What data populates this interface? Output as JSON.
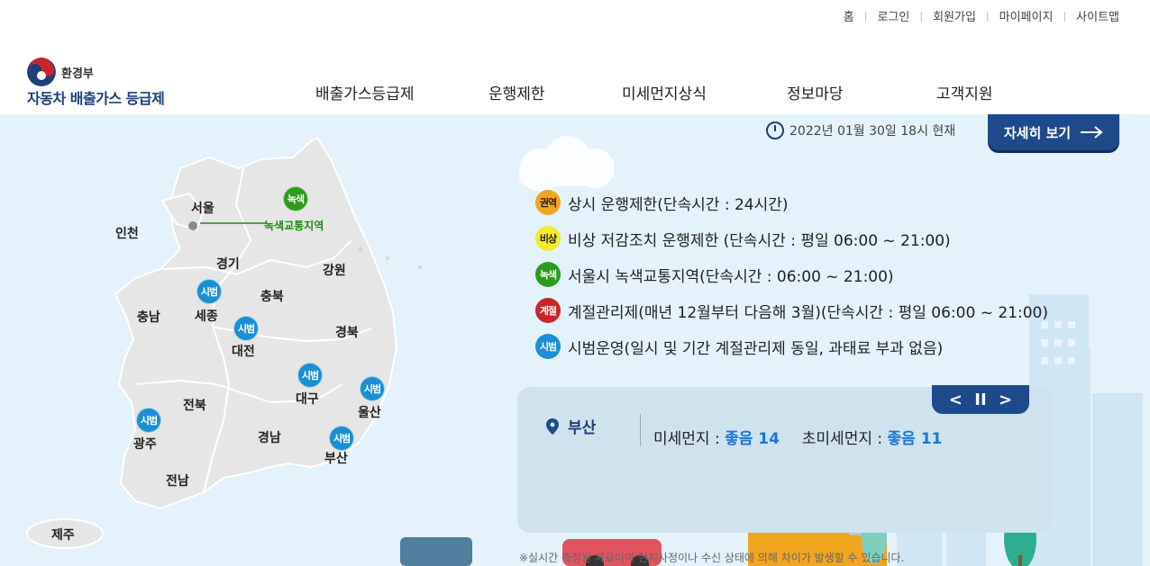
{
  "utility_nav": [
    "홈",
    "로그인",
    "회원가입",
    "마이페이지",
    "사이트맵"
  ],
  "logo": {
    "ministry": "환경부",
    "service": "자동차 배출가스 등급제"
  },
  "gnb": [
    "배출가스등급제",
    "운행제한",
    "미세먼지상식",
    "정보마당",
    "고객지원"
  ],
  "map": {
    "regions": [
      "서울",
      "인천",
      "경기",
      "강원",
      "충북",
      "충남",
      "세종",
      "대전",
      "경북",
      "대구",
      "울산",
      "전북",
      "광주",
      "경남",
      "부산",
      "전남",
      "제주"
    ],
    "green_zone_badge": "녹색",
    "green_zone_label": "녹색교통지역",
    "pilot_badge": "시범"
  },
  "timestamp": "2022년 01월 30일 18시 현재",
  "detail_button": "자세히 보기",
  "legend": [
    {
      "badge": "권역",
      "text": "상시 운행제한(단속시간 : 24시간)",
      "color": "#f2a51e",
      "text_color": "#222222"
    },
    {
      "badge": "비상",
      "text": "비상 저감조치 운행제한 (단속시간 : 평일 06:00 ~ 21:00)",
      "color": "#f5ea2b",
      "text_color": "#222222"
    },
    {
      "badge": "녹색",
      "text": "서울시 녹색교통지역(단속시간 : 06:00 ~ 21:00)",
      "color": "#2e9b1f",
      "text_color": "#ffffff"
    },
    {
      "badge": "계절",
      "text": "계절관리제(매년 12월부터 다음해 3월)(단속시간 : 평일 06:00 ~ 21:00)",
      "color": "#c8262b",
      "text_color": "#ffffff"
    },
    {
      "badge": "시범",
      "text": "시범운영(일시 및 기간 계절관리제 동일, 과태료 부과 없음)",
      "color": "#1a8fd3",
      "text_color": "#ffffff"
    }
  ],
  "air": {
    "location": "부산",
    "pm10_label": "미세먼지 :",
    "pm10_value": "좋음 14",
    "pm25_label": "초미세먼지 :",
    "pm25_value": "좋음 11",
    "controls": {
      "prev": "<",
      "pause": "II",
      "next": ">"
    }
  },
  "note": "※실시간 측정된 자료이며 현지사정이나 수신 상태에 의해 차이가 발생할 수 있습니다."
}
